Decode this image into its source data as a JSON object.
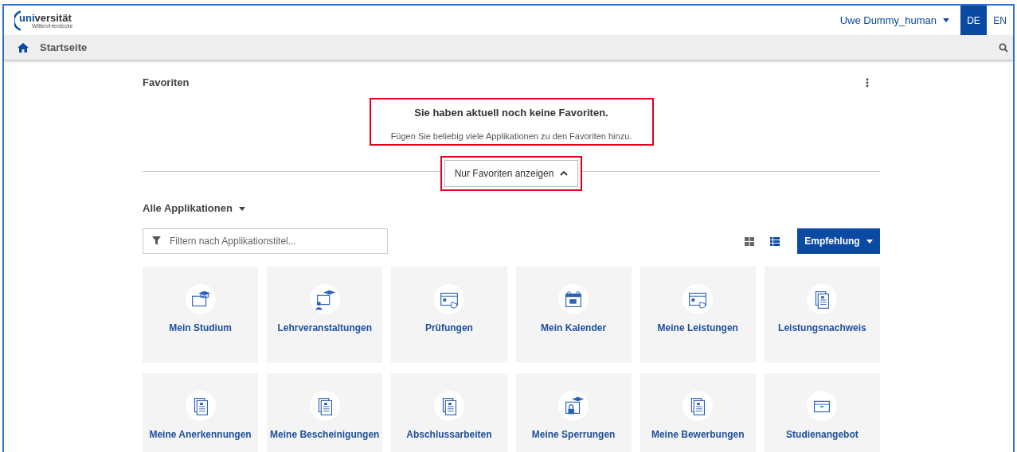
{
  "header": {
    "logo": {
      "main": "uni",
      "rest": "versität",
      "sub": "Witten/Herdecke"
    },
    "user": "Uwe Dummy_human",
    "languages": [
      {
        "label": "DE",
        "selected": true
      },
      {
        "label": "EN",
        "selected": false
      }
    ]
  },
  "nav": {
    "title": "Startseite"
  },
  "favorites": {
    "title": "Favoriten",
    "empty_title": "Sie haben aktuell noch keine Favoriten.",
    "empty_text": "Fügen Sie beliebig viele Applikationen zu den Favoriten hinzu.",
    "toggle": "Nur Favoriten anzeigen"
  },
  "applications": {
    "title": "Alle Applikationen",
    "filter": {
      "placeholder": "Filtern nach Applikationstitel..."
    },
    "views": [
      {
        "kind": "tiles",
        "selected": false
      },
      {
        "kind": "list",
        "selected": true
      }
    ],
    "sort": "Empfehlung",
    "tiles": [
      {
        "label": "Mein Studium",
        "kind": "cap"
      },
      {
        "label": "Lehrveranstaltungen",
        "kind": "lecture"
      },
      {
        "label": "Prüfungen",
        "kind": "screen"
      },
      {
        "label": "Mein Kalender",
        "kind": "calendar"
      },
      {
        "label": "Meine Leistungen",
        "kind": "screen"
      },
      {
        "label": "Leistungsnachweis",
        "kind": "document"
      },
      {
        "label": "Meine Anerkennungen",
        "kind": "document"
      },
      {
        "label": "Meine Bescheinigungen",
        "kind": "document"
      },
      {
        "label": "Abschlussarbeiten",
        "kind": "document"
      },
      {
        "label": "Meine Sperrungen",
        "kind": "lock"
      },
      {
        "label": "Meine Bewerbungen",
        "kind": "document"
      },
      {
        "label": "Studienangebot",
        "kind": "window"
      }
    ]
  }
}
